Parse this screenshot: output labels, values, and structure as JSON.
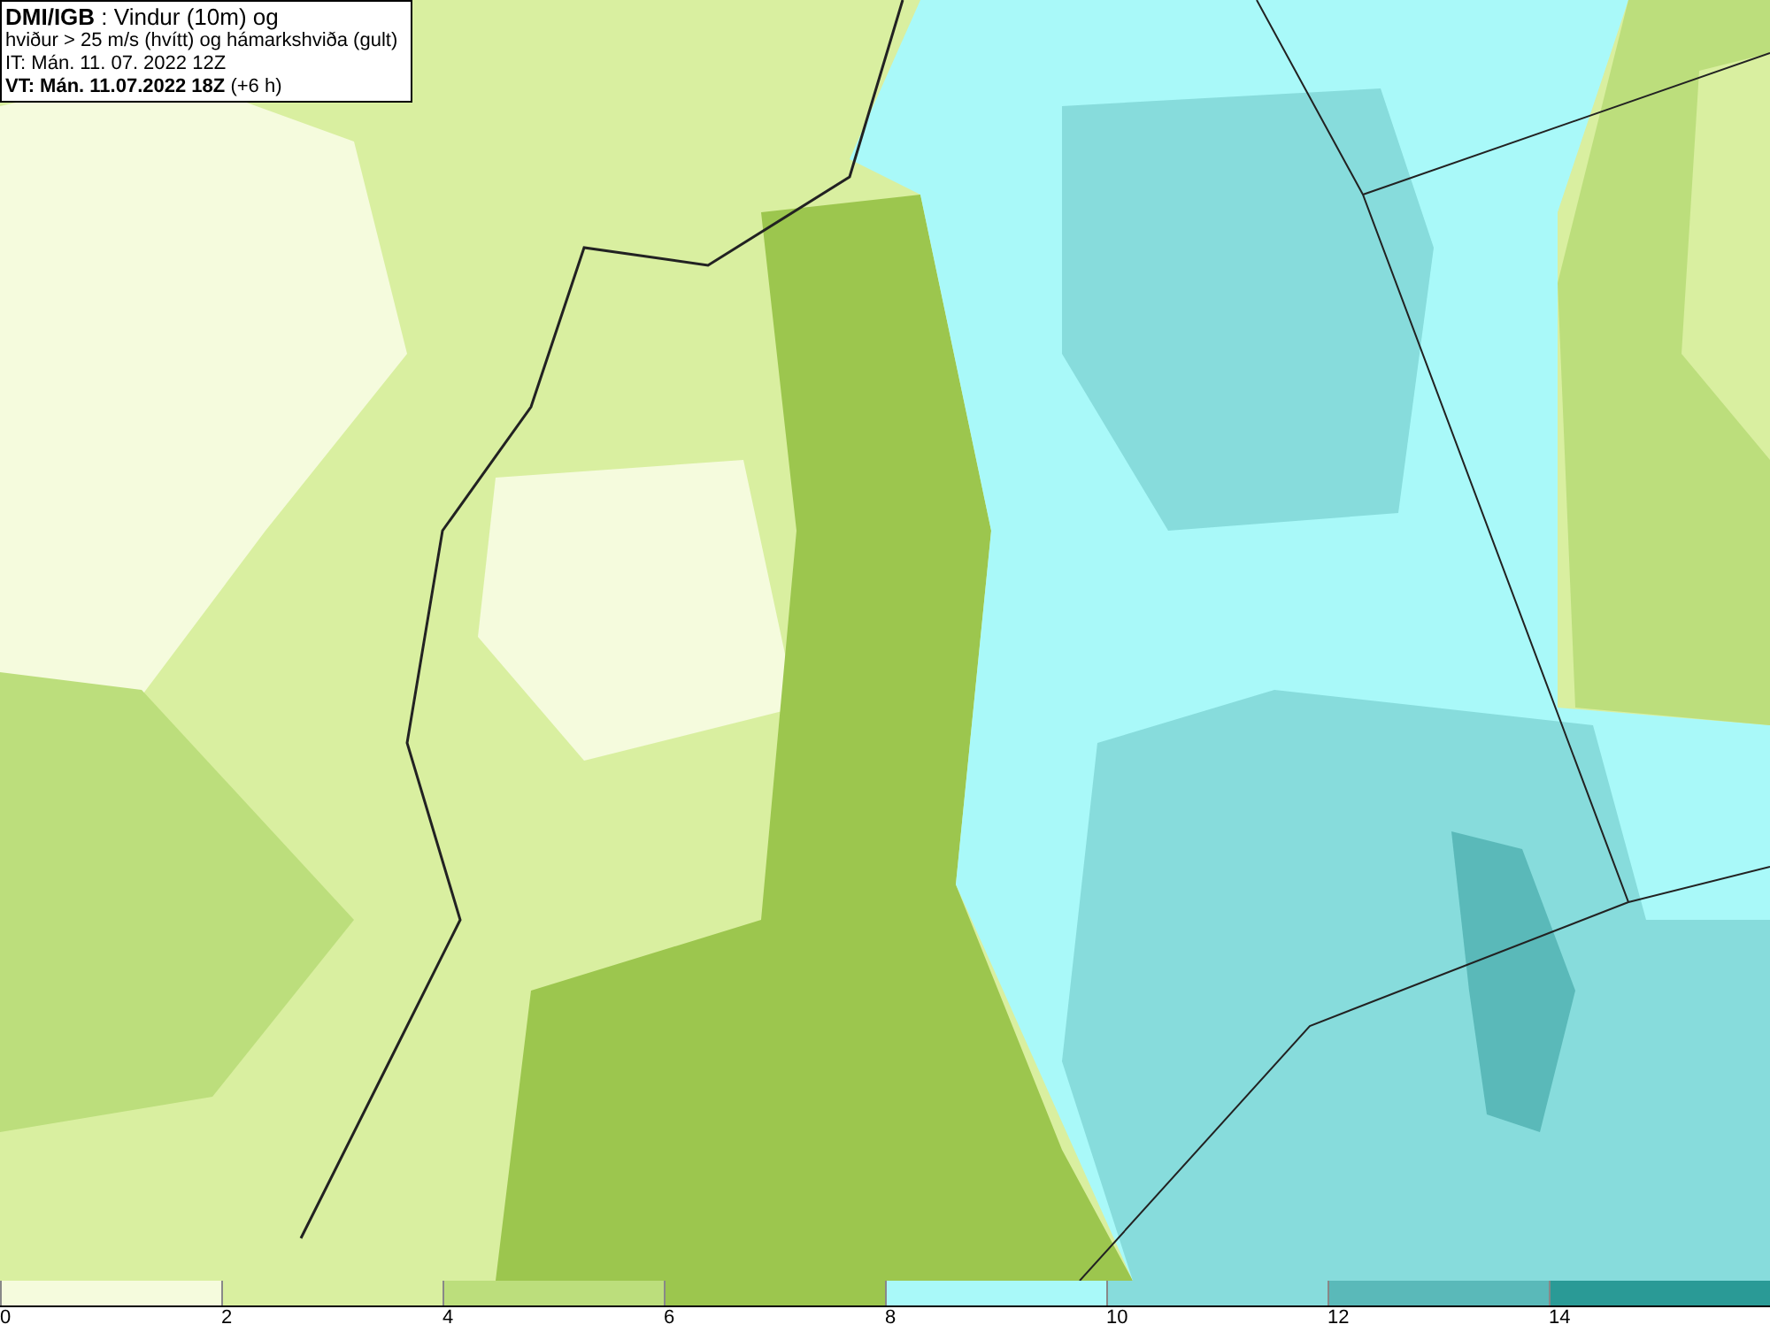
{
  "info_box": {
    "lines": [
      "**DMI/IGB** : Vindur (10m) og",
      "hviður > 25 m/s (hvítt) og hámarkshviða (gult)",
      "IT: Mán. 11. 07. 2022 12Z",
      "**VT: Mán. 11.07.2022 18Z** (+6 h)"
    ]
  },
  "legend": {
    "bins": [
      {
        "color": "#f5fbdd"
      },
      {
        "color": "#d9efa0"
      },
      {
        "color": "#bcde7c"
      },
      {
        "color": "#9cc64e"
      },
      {
        "color": "#a9f9f9"
      },
      {
        "color": "#87dcdc"
      },
      {
        "color": "#5ab9b9"
      },
      {
        "color": "#2a9a96"
      }
    ],
    "ticks": [
      "0",
      "2",
      "4",
      "6",
      "8",
      "10",
      "12",
      "14"
    ]
  }
}
